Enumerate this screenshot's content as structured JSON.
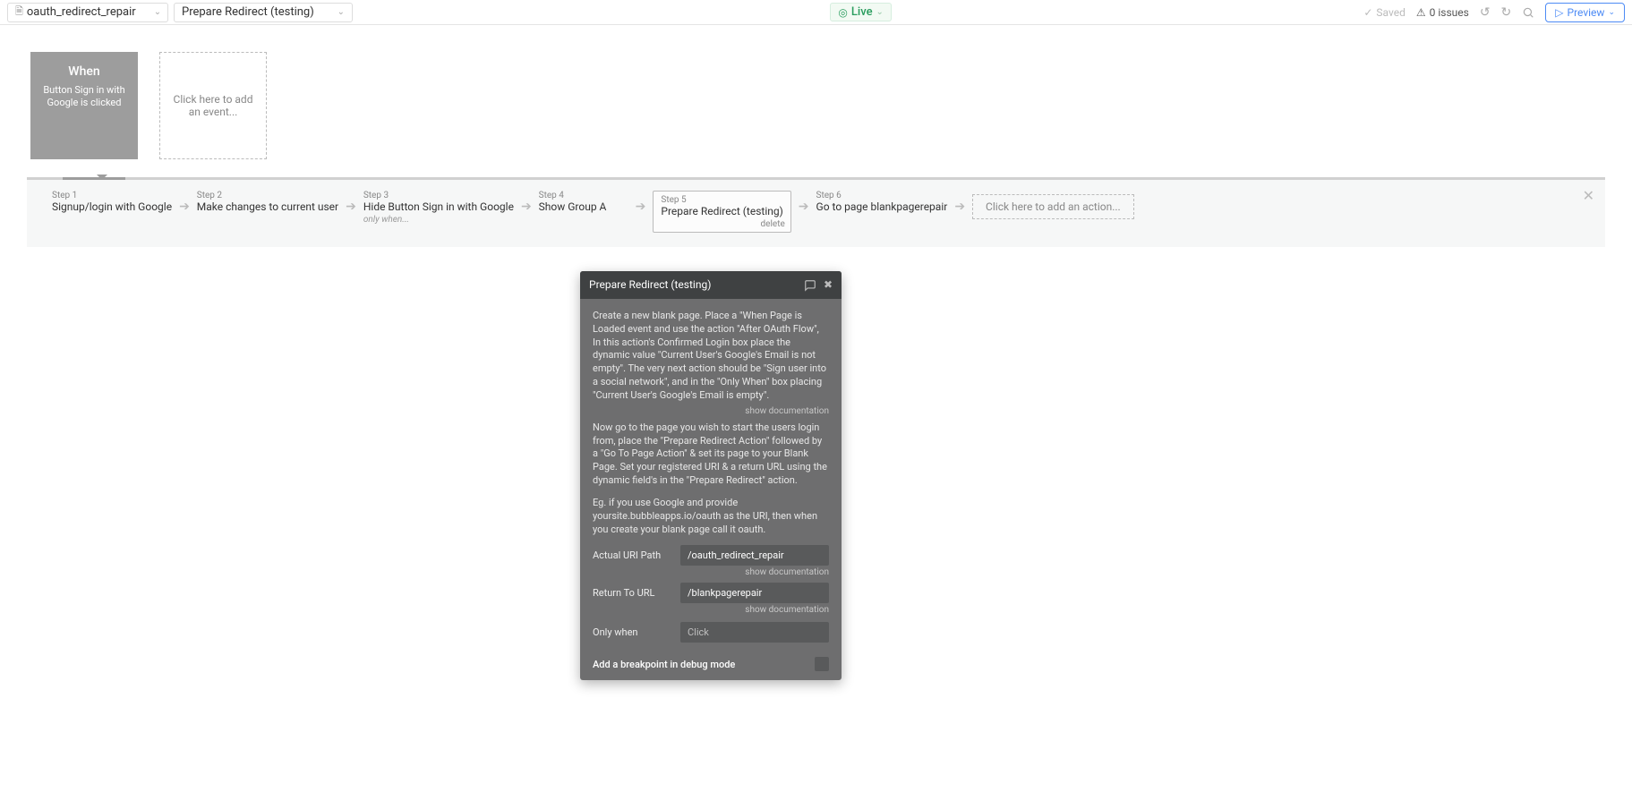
{
  "header": {
    "page_name": "oauth_redirect_repair",
    "workflow_name": "Prepare Redirect (testing)",
    "live_label": "Live",
    "saved_label": "Saved",
    "issues_label": "0 issues",
    "preview_label": "Preview"
  },
  "events": {
    "when_label": "When",
    "when_desc": "Button Sign in with Google is clicked",
    "add_event": "Click here to add an event..."
  },
  "steps": {
    "s1_lbl": "Step 1",
    "s1": "Signup/login with Google",
    "s2_lbl": "Step 2",
    "s2": "Make changes to current user",
    "s3_lbl": "Step 3",
    "s3": "Hide Button Sign in with Google",
    "s3_only": "only when...",
    "s4_lbl": "Step 4",
    "s4": "Show Group A",
    "s5_lbl": "Step 5",
    "s5": "Prepare Redirect (testing)",
    "s5_delete": "delete",
    "s6_lbl": "Step 6",
    "s6": "Go to page blankpagerepair",
    "add_action": "Click here to add an action..."
  },
  "popup": {
    "title": "Prepare Redirect (testing)",
    "para1": "Create a new blank page. Place a \"When Page is Loaded event and use the action \"After OAuth Flow\", In this action's Confirmed Login box place the dynamic value \"Current User's Google's Email is not empty\". The very next action should be \"Sign user into a social network\", and in the \"Only When\" box placing \"Current User's Google's Email is empty\".",
    "show_doc": "show documentation",
    "para2": "Now go to the page you wish to start the users login from, place the \"Prepare Redirect Action\" followed by a \"Go To Page Action\" & set its page to your Blank Page. Set your registered URI & a return URL using the dynamic field's in the \"Prepare Redirect\" action.",
    "para3": "Eg. if you use Google and provide yoursite.bubbleapps.io/oauth as the URI, then when you create your blank page call it oauth.",
    "uri_label": "Actual URI Path",
    "uri_value": "/oauth_redirect_repair",
    "return_label": "Return To URL",
    "return_value": "/blankpagerepair",
    "only_when_label": "Only when",
    "only_when_placeholder": "Click",
    "breakpoint_label": "Add a breakpoint in debug mode"
  }
}
